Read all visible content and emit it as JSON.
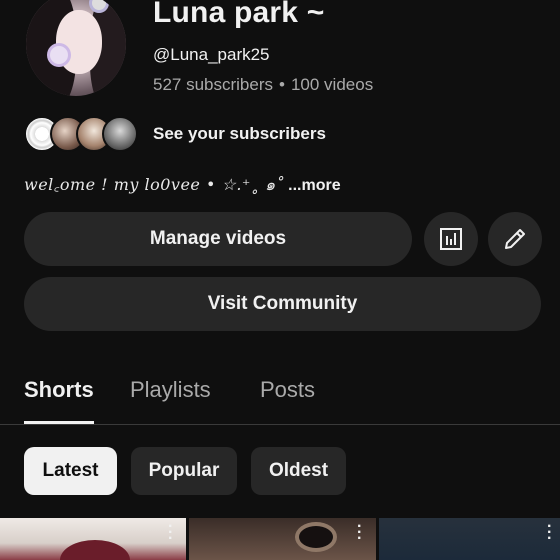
{
  "channel": {
    "name": "Luna park ~",
    "handle": "@Luna_park25",
    "subscribers": "527 subscribers",
    "separator": "•",
    "videos": "100 videos",
    "see_subscribers": "See your subscribers",
    "description": "wel꜀ome ! my lo0vee • ☆.⁺˳ ๑˚",
    "more": "...more"
  },
  "actions": {
    "manage_videos": "Manage videos",
    "visit_community": "Visit Community",
    "analytics_icon": "analytics-icon",
    "edit_icon": "pencil-icon"
  },
  "tabs": [
    {
      "label": "Shorts",
      "active": true
    },
    {
      "label": "Playlists",
      "active": false
    },
    {
      "label": "Posts",
      "active": false
    }
  ],
  "filters": [
    {
      "label": "Latest",
      "selected": true
    },
    {
      "label": "Popular",
      "selected": false
    },
    {
      "label": "Oldest",
      "selected": false
    }
  ]
}
